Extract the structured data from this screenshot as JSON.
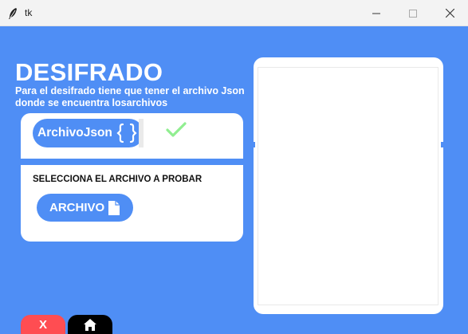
{
  "window": {
    "title": "tk",
    "feather_icon": "feather-icon",
    "controls": [
      "minimize-icon",
      "maximize-icon",
      "close-icon"
    ]
  },
  "header": {
    "title": "DESIFRADO",
    "description": "Para el desifrado tiene que tener el archivo Json donde se encuentra losarchivos"
  },
  "left_card": {
    "json_button_label": "ArchivoJson",
    "json_icon": "braces-icon",
    "status_icon": "check-icon",
    "select_label": "SELECCIONA EL ARCHIVO A PROBAR",
    "archivo_button_label": "ARCHIVO",
    "archivo_icon": "file-icon"
  },
  "right_panel": {
    "content": ""
  },
  "bottom": {
    "exit_label": "X",
    "home_icon": "home-icon"
  },
  "colors": {
    "background": "#4f8ef5",
    "button": "#4f8ef5",
    "exit": "#ff4d52",
    "home": "#000000",
    "check": "#90ee90"
  }
}
